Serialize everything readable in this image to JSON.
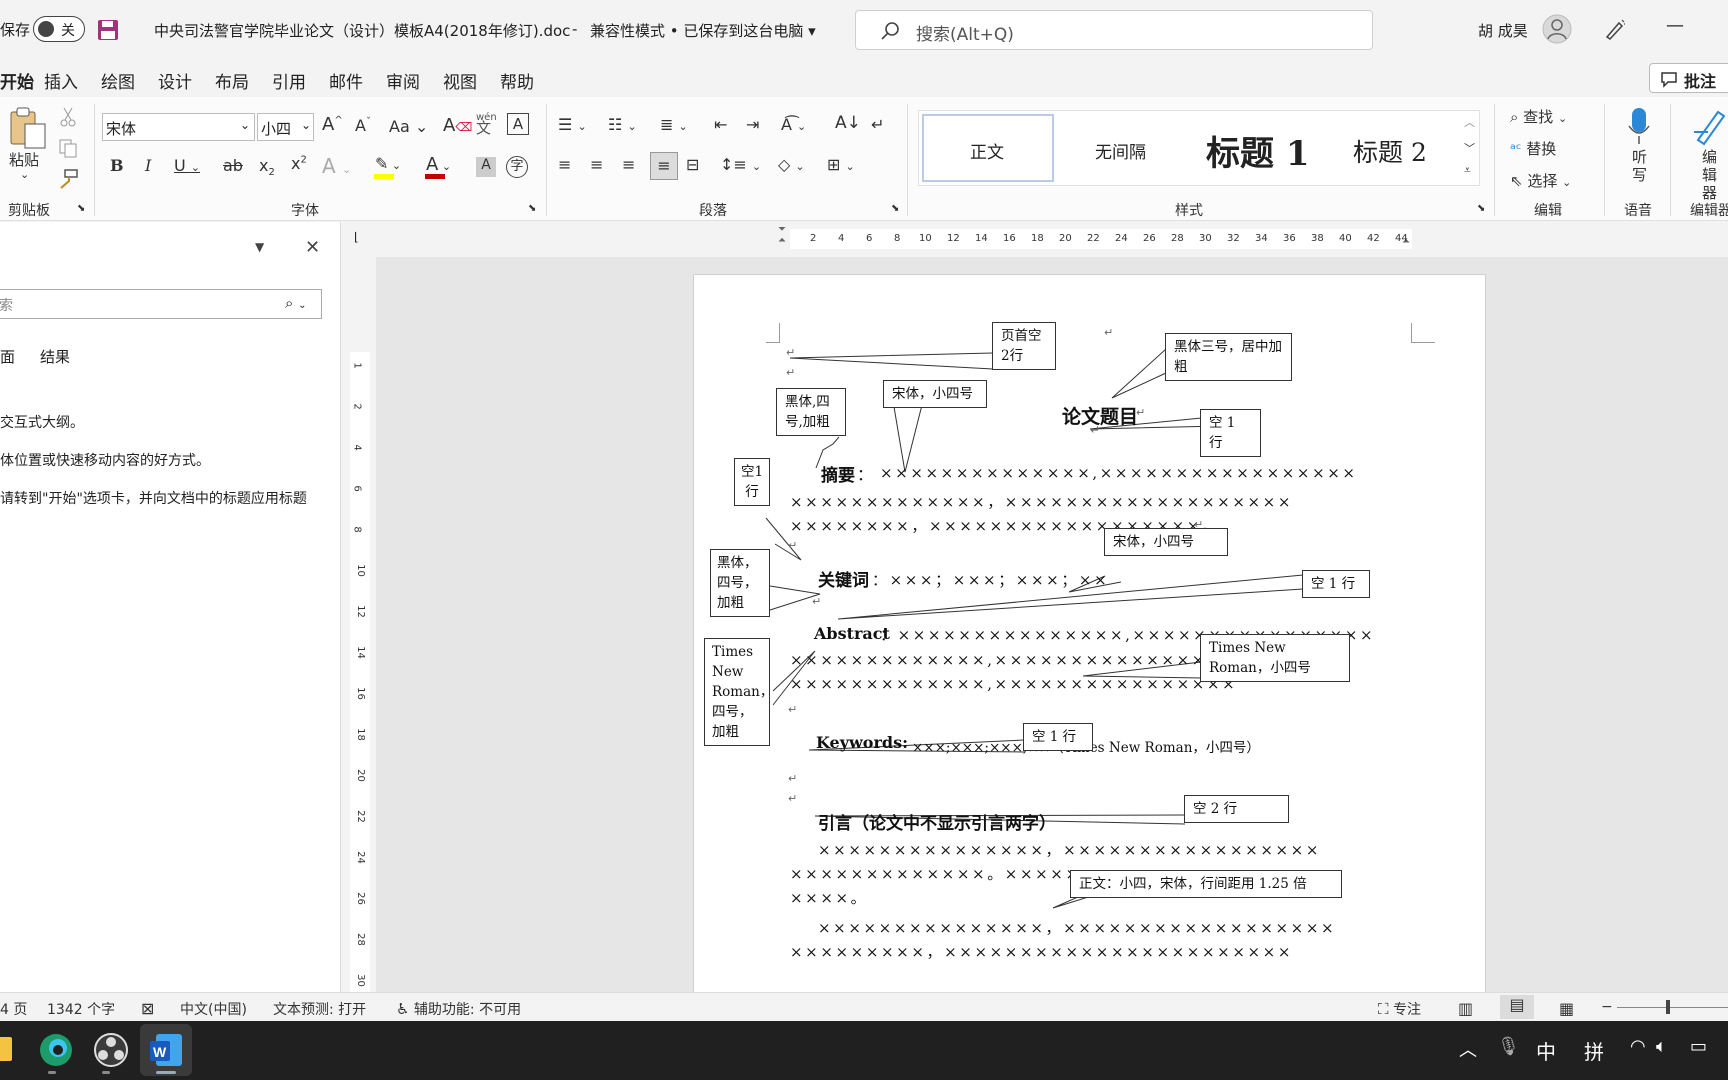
{
  "titlebar": {
    "autosave_label": "保存",
    "autosave_state": "关",
    "document_title": "中央司法警官学院毕业论文（设计）模板A4(2018年修订).doc",
    "title_sep": "-",
    "document_status": "兼容性模式 • 已保存到这台电脑",
    "search_placeholder": "搜索(Alt+Q)",
    "user_name": "胡 成昊",
    "minimize": "—"
  },
  "menu": {
    "tabs": [
      "开始",
      "插入",
      "绘图",
      "设计",
      "布局",
      "引用",
      "邮件",
      "审阅",
      "视图",
      "帮助"
    ],
    "comment_button": "批注"
  },
  "ribbon": {
    "clipboard": {
      "paste": "粘贴",
      "group": "剪贴板"
    },
    "font": {
      "name": "宋体",
      "size": "小四",
      "group": "字体",
      "case": "Aa",
      "phonetic": "wén"
    },
    "paragraph": {
      "group": "段落"
    },
    "styles": {
      "items": [
        "正文",
        "无间隔",
        "标题 1",
        "标题 2"
      ],
      "group": "样式"
    },
    "editing": {
      "find": "查找",
      "replace": "替换",
      "select": "选择",
      "group": "编辑"
    },
    "voice": {
      "dictate": "听写",
      "group": "语音"
    },
    "editor": {
      "label": "编辑器",
      "group": "编辑器"
    }
  },
  "navpane": {
    "search_placeholder": "索",
    "tabs": [
      "面",
      "结果"
    ],
    "hint1": "交互式大纲。",
    "hint2": "体位置或快速移动内容的好方式。",
    "hint3": "请转到\"开始\"选项卡，并向文档中的标题应用标题"
  },
  "ruler": {
    "h_numbers": [
      "2",
      "4",
      "6",
      "8",
      "10",
      "12",
      "14",
      "16",
      "18",
      "20",
      "22",
      "24",
      "26",
      "28",
      "30",
      "32",
      "34",
      "36",
      "38",
      "40",
      "42",
      "44"
    ],
    "v_numbers": [
      "1",
      "2",
      "4",
      "6",
      "8",
      "10",
      "12",
      "14",
      "16",
      "18",
      "20",
      "22",
      "24",
      "26",
      "28",
      "30"
    ]
  },
  "document": {
    "title": "论文题目",
    "abstract_label": "摘要",
    "abstract_colon": "：",
    "abstract_line1": "××××××××××××××,×××××××××××××××××",
    "abstract_line2": "×××××××××××××，×××××××××××××××××××",
    "abstract_line3": "××××××××，××××××××××××××××××。",
    "keywords_label": "关键词",
    "keywords_text": "：×××；×××；×××；××",
    "en_abstract_label": "Abstract",
    "en_abstract_line1": "：×××××××××××××××,××××××××××××××××",
    "en_abstract_line2": "×××××××××××××,××××××××××××××××××",
    "en_abstract_line3": "×××××××××××××,××××××××××××××××",
    "en_keywords_label": "Keywords:",
    "en_keywords_text": "×××;×××;×××;××（Times New Roman，小四号）",
    "intro_heading": "引言（论文中不显示引言两字）",
    "body_line1": "×××××××××××××××，×××××××××××××××××",
    "body_line2": "×××××××××××××。×××××××××××××××××××",
    "body_line3": "××××。",
    "body_line4": "×××××××××××××××，××××××××××××××××××",
    "body_line5": "×××××××××，×××××××××××××××××××××××"
  },
  "callouts": {
    "header_space": "页首空2行",
    "title_font": "黑体三号，居中加粗",
    "abstract_label_font": "黑体,四号,加粗",
    "abstract_text_font": "宋体，小四号",
    "blank1_title": "空 1 行",
    "blank1_vertical": "空1行",
    "keywords_label_font": "黑体，四号，加粗",
    "keywords_text_font": "宋体，小四号",
    "blank1_keywords": "空 1 行",
    "en_label_font": "Times New Roman，四号，加粗",
    "en_text_font": "Times New Roman，小四号",
    "blank1_en": "空 1 行",
    "blank2": "空 2 行",
    "body_font": "正文：小四，宋体，行间距用 1.25 倍"
  },
  "statusbar": {
    "page": "4 页",
    "words": "1342 个字",
    "language": "中文(中国)",
    "prediction": "文本预测: 打开",
    "accessibility": "辅助功能: 不可用",
    "focus": "专注"
  },
  "taskbar": {
    "ime_lang": "中",
    "ime_mode": "拼"
  },
  "colors": {
    "accent": "#185abd",
    "save_icon": "#a0337c",
    "font_color_bar": "#c00000",
    "highlight_bar": "#ffff00",
    "dictate_icon": "#2b88d8"
  }
}
